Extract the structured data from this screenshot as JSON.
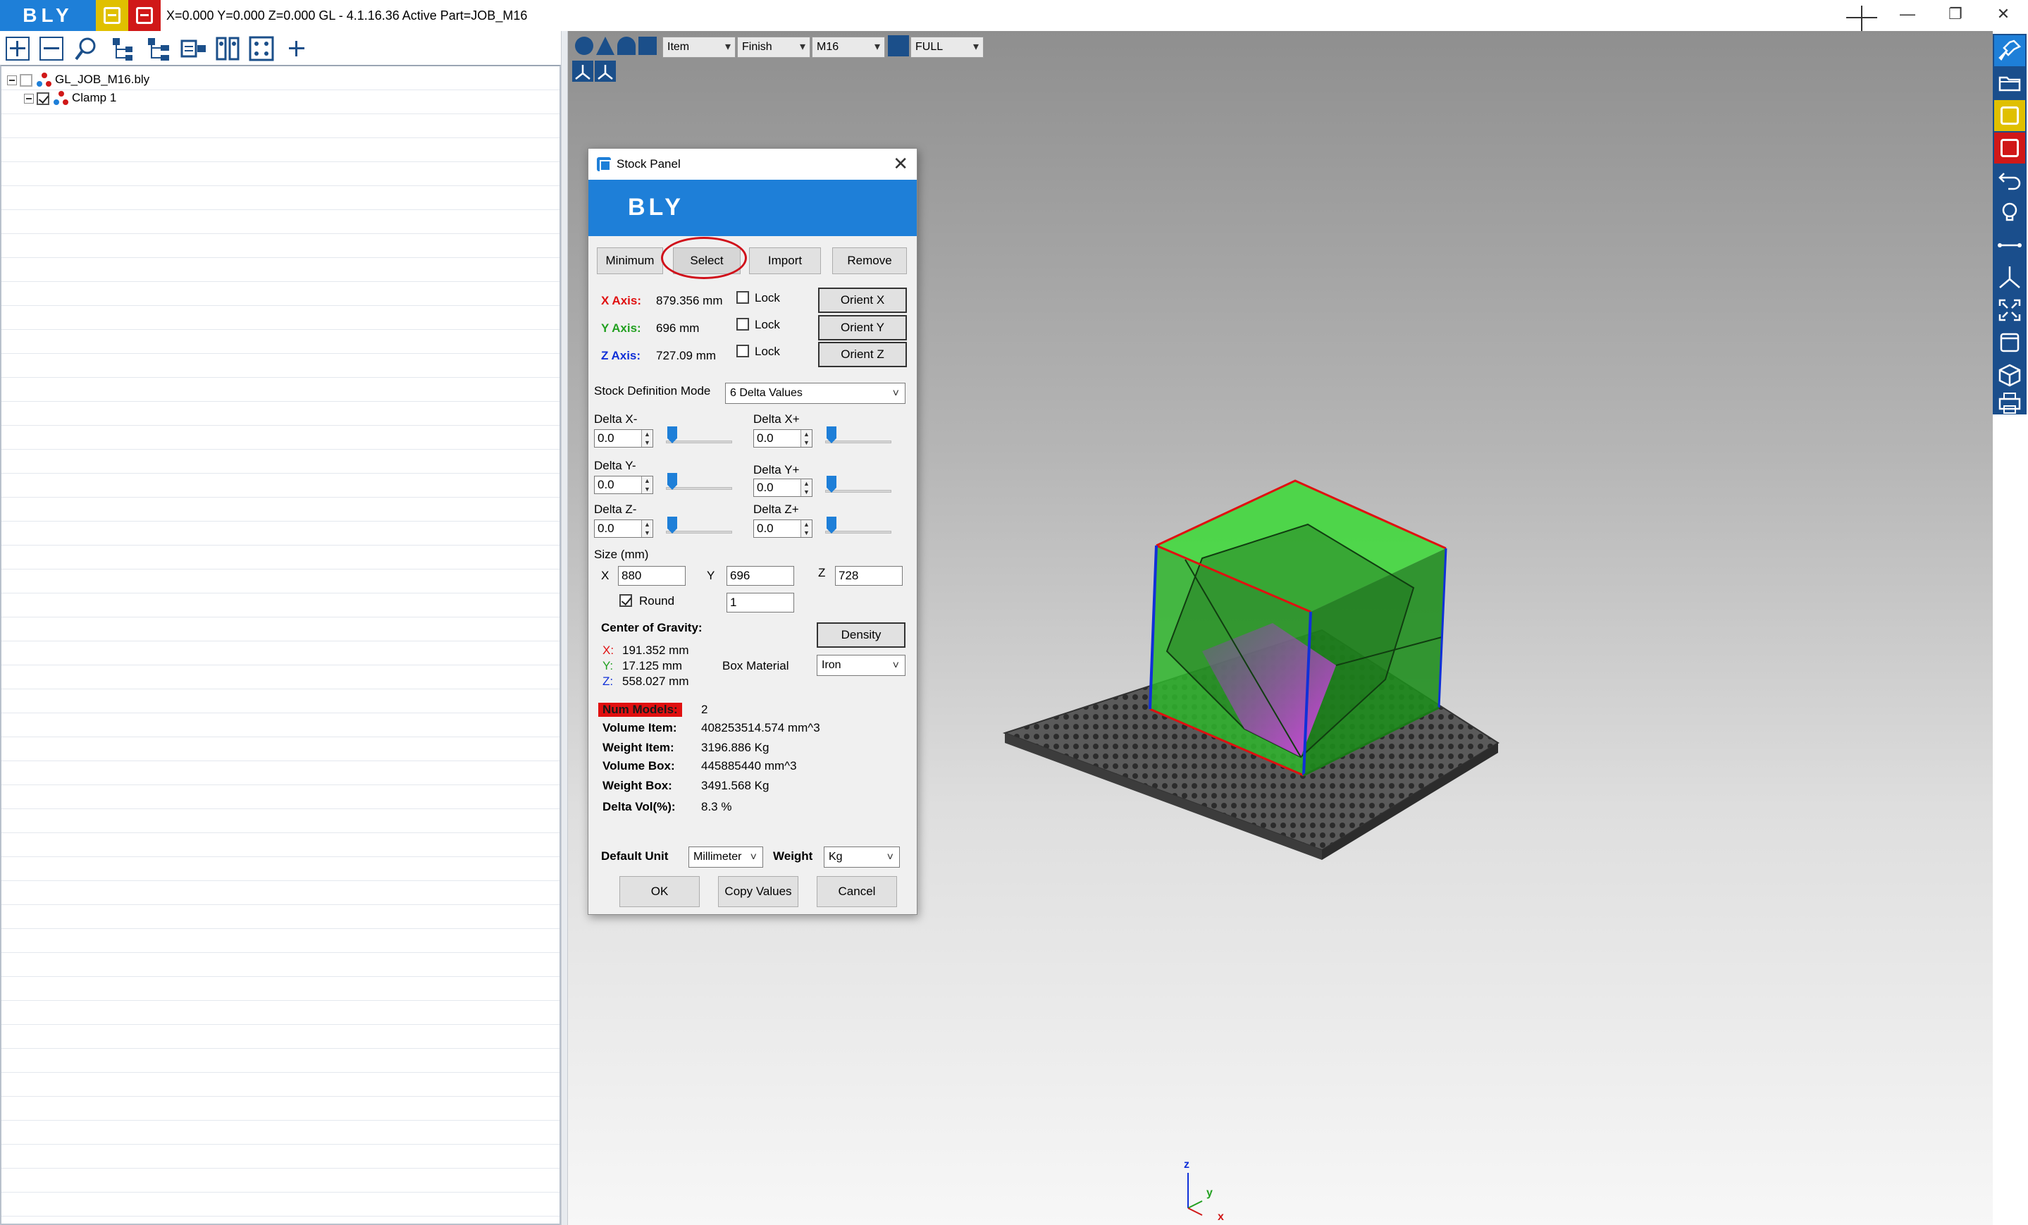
{
  "app": {
    "logo": "BLY",
    "title": "X=0.000 Y=0.000 Z=0.000   GL - 4.1.16.36 Active Part=JOB_M16"
  },
  "window_controls": {
    "minimize": "—",
    "restore": "❐",
    "close": "✕"
  },
  "tree": {
    "items": [
      {
        "label": "GL_JOB_M16.bly"
      },
      {
        "label": "Clamp 1"
      }
    ]
  },
  "viewport_toolbar": {
    "item_combo": "Item",
    "finish_combo": "Finish",
    "part_combo": "M16",
    "view_combo": "FULL"
  },
  "dialog": {
    "title": "Stock Panel",
    "banner": "BLY",
    "buttons": {
      "minimum": "Minimum",
      "select": "Select",
      "import": "Import",
      "remove": "Remove",
      "orient_x": "Orient X",
      "orient_y": "Orient Y",
      "orient_z": "Orient Z",
      "density": "Density",
      "ok": "OK",
      "copy_values": "Copy Values",
      "cancel": "Cancel"
    },
    "axes": {
      "x_label": "X Axis:",
      "x_value": "879.356 mm",
      "y_label": "Y Axis:",
      "y_value": "696 mm",
      "z_label": "Z Axis:",
      "z_value": "727.09 mm",
      "lock_label": "Lock"
    },
    "stock_definition": {
      "label": "Stock Definition Mode",
      "value": "6 Delta Values"
    },
    "deltas": {
      "x_minus_label": "Delta X-",
      "x_minus": "0.0",
      "x_plus_label": "Delta X+",
      "x_plus": "0.0",
      "y_minus_label": "Delta Y-",
      "y_minus": "0.0",
      "y_plus_label": "Delta Y+",
      "y_plus": "0.0",
      "z_minus_label": "Delta Z-",
      "z_minus": "0.0",
      "z_plus_label": "Delta Z+",
      "z_plus": "0.0"
    },
    "size": {
      "label": "Size (mm)",
      "x_label": "X",
      "x": "880",
      "y_label": "Y",
      "y": "696",
      "z_label": "Z",
      "z": "728",
      "round_label": "Round",
      "round_value": "1"
    },
    "cog": {
      "label": "Center of Gravity:",
      "x_label": "X:",
      "x": "191.352 mm",
      "y_label": "Y:",
      "y": "17.125 mm",
      "z_label": "Z:",
      "z": "558.027 mm"
    },
    "material": {
      "label": "Box Material",
      "value": "Iron"
    },
    "stats": {
      "num_models_label": "Num Models:",
      "num_models": "2",
      "volume_item_label": "Volume Item:",
      "volume_item": "408253514.574 mm^3",
      "weight_item_label": "Weight Item:",
      "weight_item": "3196.886 Kg",
      "volume_box_label": "Volume Box:",
      "volume_box": "445885440 mm^3",
      "weight_box_label": "Weight Box:",
      "weight_box": "3491.568 Kg",
      "delta_vol_label": "Delta Vol(%):",
      "delta_vol": "8.3 %"
    },
    "units": {
      "default_unit_label": "Default Unit",
      "default_unit": "Millimeter",
      "weight_label": "Weight",
      "weight": "Kg"
    }
  },
  "axis_triad": {
    "z": "z",
    "y": "y",
    "x": "x"
  },
  "colors": {
    "brand_blue": "#1e7fd8",
    "brand_yellow": "#e0c000",
    "brand_red": "#d01818",
    "stock_green": "#22c51e",
    "highlight_red": "#e01010"
  }
}
